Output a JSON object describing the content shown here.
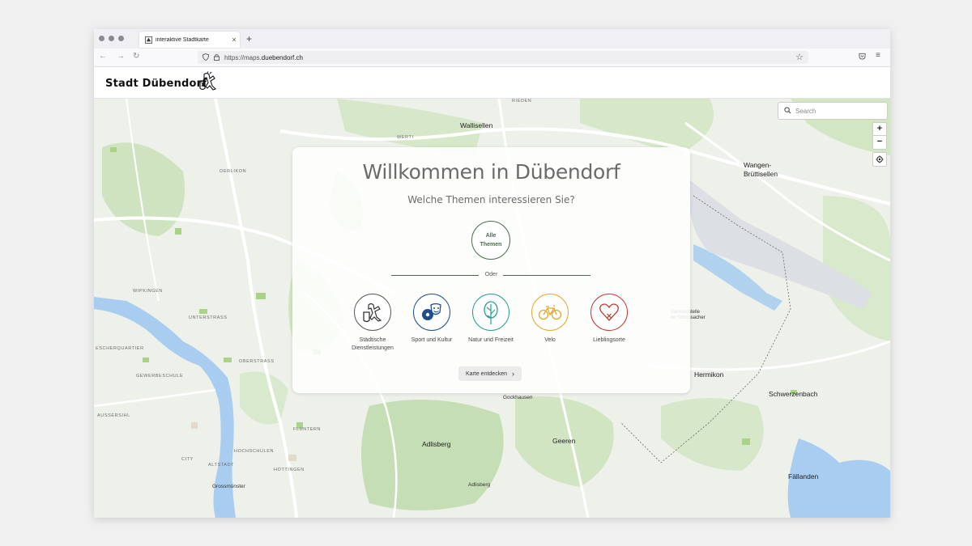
{
  "browser": {
    "tab_title": "interaktive Stadtkarte",
    "tab_close": "×",
    "new_tab": "+",
    "url_prefix": "https://maps.",
    "url_domain": "duebendorf.ch",
    "nav_back": "←",
    "nav_forward": "→",
    "nav_reload": "↻",
    "bookmark": "☆",
    "menu": "≡"
  },
  "header": {
    "brand": "Stadt Dübendorf"
  },
  "map": {
    "search_placeholder": "Search",
    "zoom_in": "+",
    "zoom_out": "−",
    "labels": [
      {
        "id": "wallisellen",
        "text": "Wallisellen"
      },
      {
        "id": "rieden",
        "text": "RIEDEN"
      },
      {
        "id": "oerlikon",
        "text": "OERLIKON"
      },
      {
        "id": "werti",
        "text": "WERTI"
      },
      {
        "id": "wangen",
        "text": "Wangen-"
      },
      {
        "id": "bruettisellen",
        "text": "Brüttisellen"
      },
      {
        "id": "wipkingen",
        "text": "WIPKINGEN"
      },
      {
        "id": "unterstrass",
        "text": "UNTERSTRASS"
      },
      {
        "id": "escherquartier",
        "text": "ESCHERQUARTIER"
      },
      {
        "id": "gewerbeschule",
        "text": "GEWERBESCHULE"
      },
      {
        "id": "aussersihl",
        "text": "AUSSERSIHL"
      },
      {
        "id": "oberstrass",
        "text": "OBERSTRASS"
      },
      {
        "id": "fluntern",
        "text": "FLUNTERN"
      },
      {
        "id": "hochschulen",
        "text": "HOCHSCHULEN"
      },
      {
        "id": "city",
        "text": "CITY"
      },
      {
        "id": "altstadt",
        "text": "ALTSTADT"
      },
      {
        "id": "hottingen",
        "text": "HOTTINGEN"
      },
      {
        "id": "grossmuenster",
        "text": "Grossmünster"
      },
      {
        "id": "adlisberg",
        "text": "Adlisberg"
      },
      {
        "id": "adlisberg2",
        "text": "Adlisberg"
      },
      {
        "id": "geeren",
        "text": "Geeren"
      },
      {
        "id": "gockhausen",
        "text": "Gockhausen"
      },
      {
        "id": "hermikon",
        "text": "Hermikon"
      },
      {
        "id": "schwerzenbach",
        "text": "Schwerzenbach"
      },
      {
        "id": "faellanden",
        "text": "Fällanden"
      },
      {
        "id": "sammelstelle",
        "text": "Sammelstelle"
      },
      {
        "id": "schossacher",
        "text": "im Schossacher"
      }
    ]
  },
  "welcome": {
    "title": "Willkommen in Dübendorf",
    "subtitle": "Welche Themen interessieren Sie?",
    "all_line1": "Alle",
    "all_line2": "Themen",
    "or": "Oder",
    "themes": [
      {
        "line1": "Städtische",
        "line2": "Dienstleistungen",
        "color": "#5a5a5a",
        "icon": "city-crest-icon"
      },
      {
        "line1": "Sport und Kultur",
        "line2": "",
        "color": "#1f4e8c",
        "icon": "sport-culture-icon"
      },
      {
        "line1": "Natur und Freizeit",
        "line2": "",
        "color": "#2a9d8f",
        "icon": "tree-icon"
      },
      {
        "line1": "Velo",
        "line2": "",
        "color": "#e0a82e",
        "icon": "bicycle-icon"
      },
      {
        "line1": "Lieblingsorte",
        "line2": "",
        "color": "#c0392b",
        "icon": "heart-icon"
      }
    ],
    "cta": "Karte entdecken",
    "cta_arrow": "›"
  }
}
